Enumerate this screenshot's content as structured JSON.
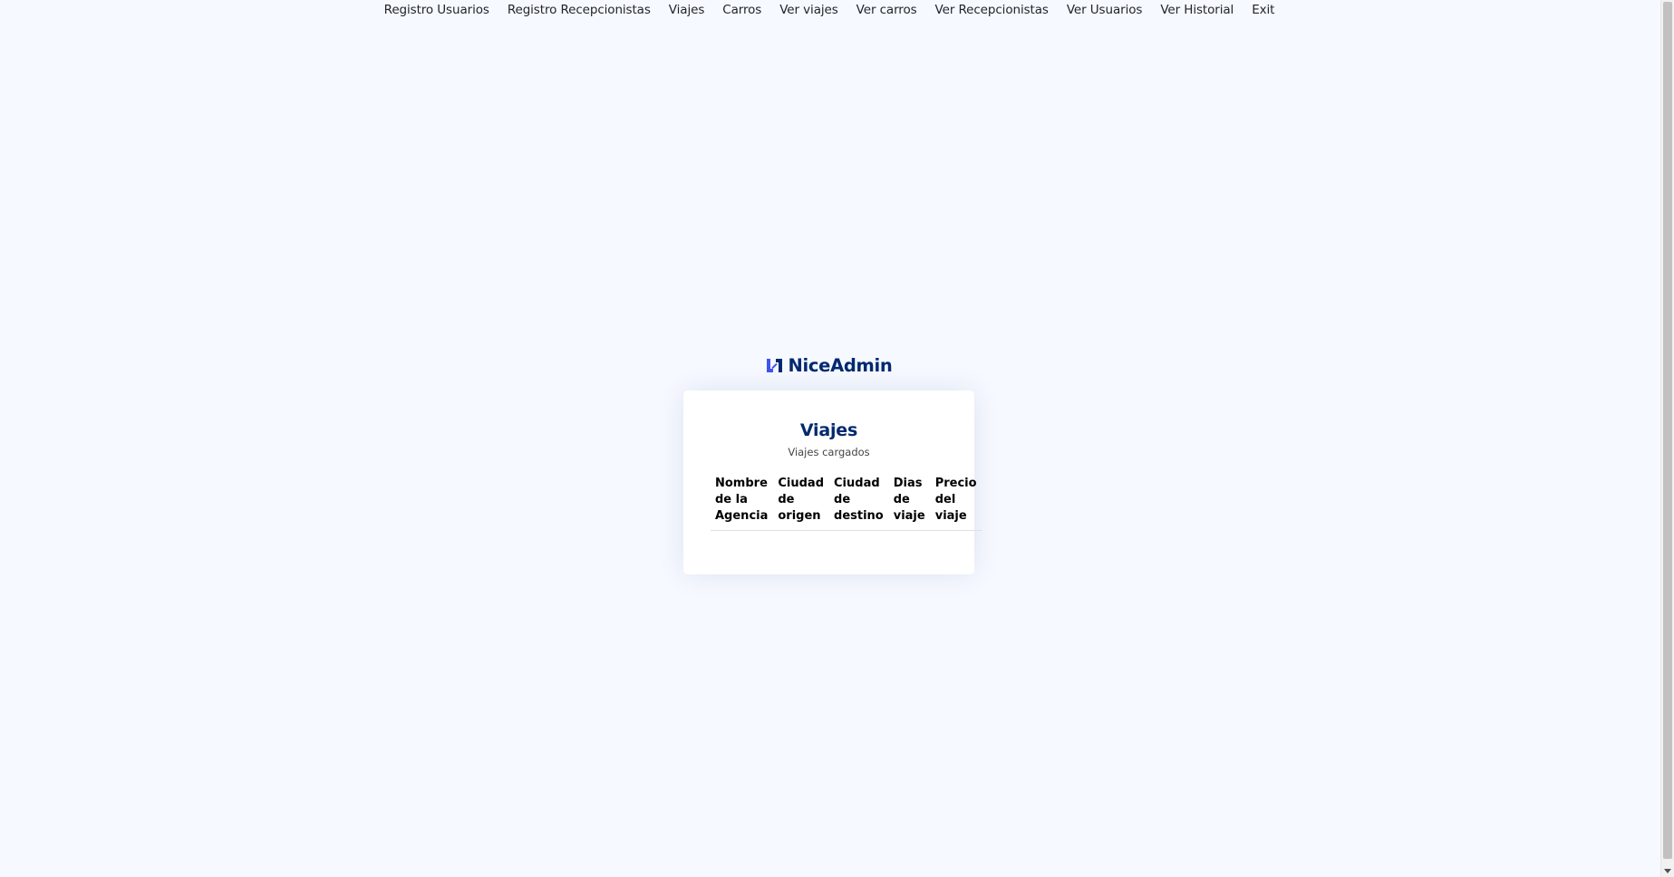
{
  "nav": {
    "items": [
      {
        "label": "Registro Usuarios"
      },
      {
        "label": "Registro Recepcionistas"
      },
      {
        "label": "Viajes"
      },
      {
        "label": "Carros"
      },
      {
        "label": "Ver viajes"
      },
      {
        "label": "Ver carros"
      },
      {
        "label": "Ver Recepcionistas"
      },
      {
        "label": "Ver Usuarios"
      },
      {
        "label": "Ver Historial"
      },
      {
        "label": "Exit"
      }
    ]
  },
  "logo": {
    "text": "NiceAdmin",
    "icon": "niceadmin-logo-icon"
  },
  "card": {
    "title": "Viajes",
    "subtitle": "Viajes cargados",
    "table": {
      "headers": [
        "Nombre de la Agencia",
        "Ciudad de origen",
        "Ciudad de destino",
        "Dias de viaje",
        "Precio del viaje"
      ],
      "rows": []
    }
  },
  "colors": {
    "background": "#f6f9ff",
    "brand": "#012970",
    "logo_accent": "#4154f1"
  }
}
